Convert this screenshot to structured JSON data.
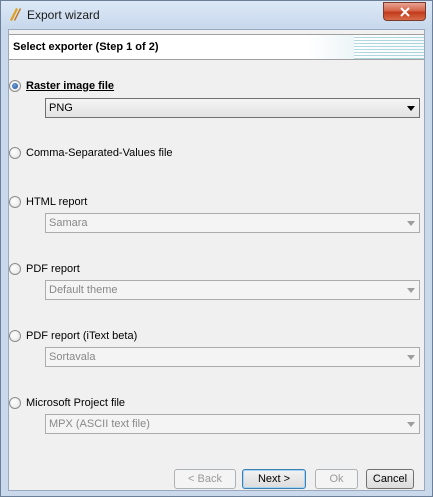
{
  "window": {
    "title": "Export wizard"
  },
  "header": {
    "title": "Select exporter  (Step 1 of 2)"
  },
  "options": [
    {
      "label": "Raster image file",
      "selected": true,
      "combo": {
        "value": "PNG",
        "enabled": true
      }
    },
    {
      "label": "Comma-Separated-Values file",
      "selected": false,
      "combo": null
    },
    {
      "label": "HTML report",
      "selected": false,
      "combo": {
        "value": "Samara",
        "enabled": false
      }
    },
    {
      "label": "PDF report",
      "selected": false,
      "combo": {
        "value": "Default theme",
        "enabled": false
      }
    },
    {
      "label": "PDF report (iText beta)",
      "selected": false,
      "combo": {
        "value": "Sortavala",
        "enabled": false
      }
    },
    {
      "label": "Microsoft Project file",
      "selected": false,
      "combo": {
        "value": "MPX (ASCII text file)",
        "enabled": false
      }
    }
  ],
  "buttons": {
    "back": "< Back",
    "next": "Next >",
    "ok": "Ok",
    "cancel": "Cancel"
  },
  "icons": {
    "app": "ganttproject-icon",
    "close": "close-icon"
  },
  "colors": {
    "close_button": "#c23a1c",
    "header_accent": "#a8d3dc"
  }
}
